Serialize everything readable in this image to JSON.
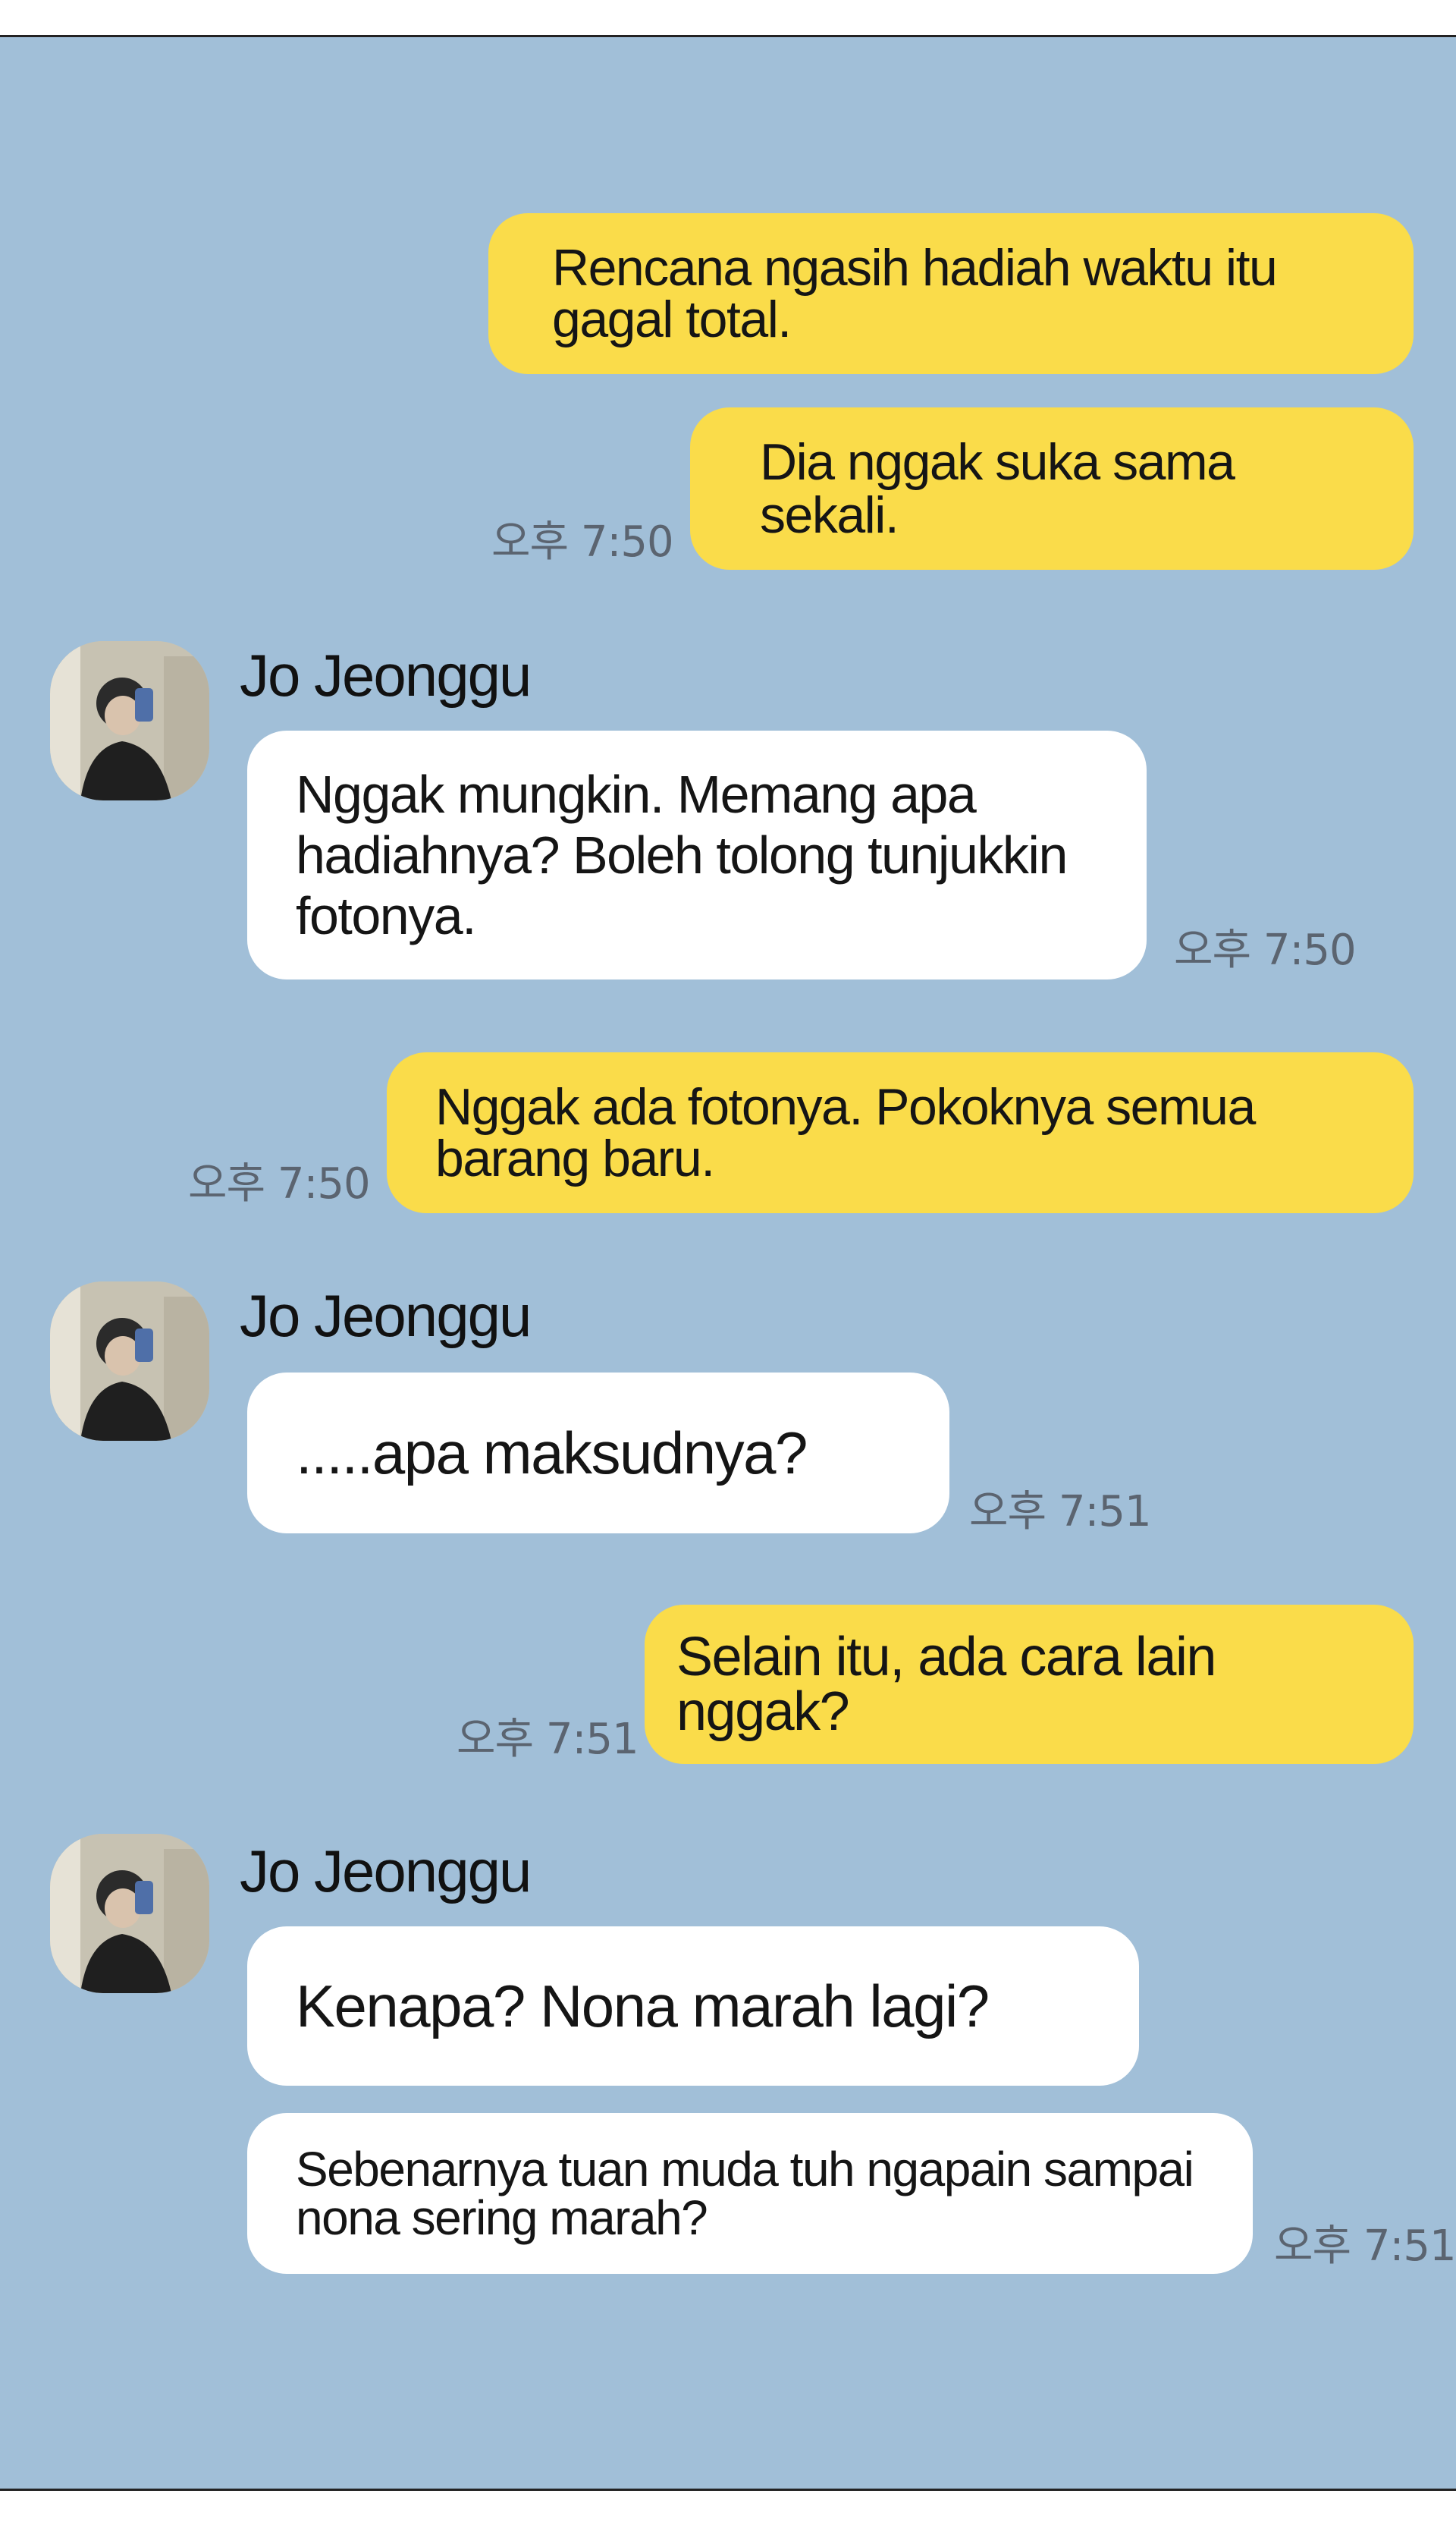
{
  "contact": {
    "name": "Jo Jeonggu"
  },
  "messages": [
    {
      "sender": "me",
      "text": "Rencana ngasih hadiah waktu itu gagal total."
    },
    {
      "sender": "me",
      "text": "Dia nggak suka sama sekali.",
      "time": "오후 7:50"
    },
    {
      "sender": "other",
      "text": "Nggak mungkin. Memang apa hadiahnya? Boleh tolong tunjukkin fotonya.",
      "time": "오후 7:50"
    },
    {
      "sender": "me",
      "text": "Nggak ada fotonya. Pokoknya semua barang baru.",
      "time": "오후 7:50"
    },
    {
      "sender": "other",
      "text": ".....apa maksudnya?",
      "time": "오후 7:51"
    },
    {
      "sender": "me",
      "text": "Selain itu, ada cara lain nggak?",
      "time": "오후 7:51"
    },
    {
      "sender": "other",
      "text": "Kenapa? Nona marah lagi?"
    },
    {
      "sender": "other",
      "text": "Sebenarnya tuan muda tuh ngapain sampai nona sering marah?",
      "time": "오후 7:51"
    }
  ],
  "colors": {
    "background": "#a1bfd8",
    "my_bubble": "#fadc4a",
    "their_bubble": "#ffffff",
    "timestamp": "#5b6470"
  },
  "icons": {
    "avatar": "profile-photo-avatar"
  }
}
